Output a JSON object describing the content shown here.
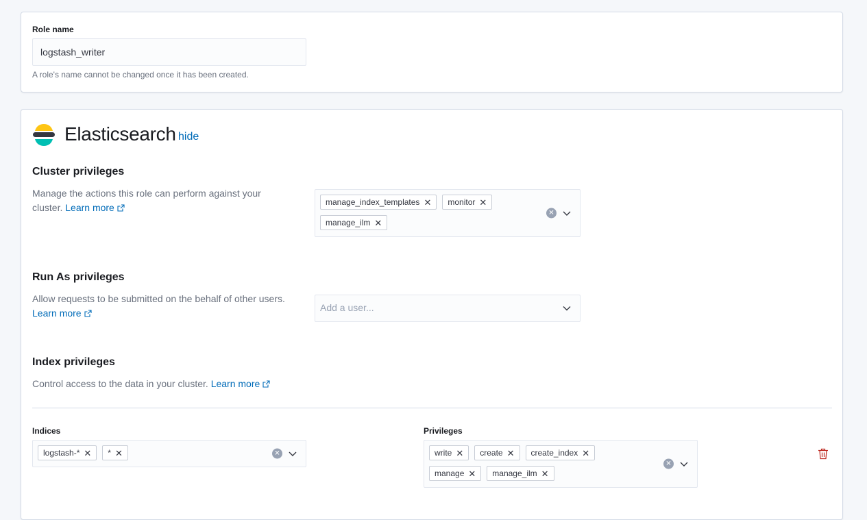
{
  "role": {
    "label": "Role name",
    "value": "logstash_writer",
    "help": "A role's name cannot be changed once it has been created."
  },
  "elasticsearch": {
    "title": "Elasticsearch",
    "hide_link": "hide",
    "cluster": {
      "title": "Cluster privileges",
      "desc": "Manage the actions this role can perform against your cluster.",
      "learn_more": "Learn more",
      "pills": [
        "manage_index_templates",
        "monitor",
        "manage_ilm"
      ]
    },
    "run_as": {
      "title": "Run As privileges",
      "desc": "Allow requests to be submitted on the behalf of other users.",
      "learn_more": "Learn more",
      "placeholder": "Add a user..."
    },
    "index": {
      "title": "Index privileges",
      "desc": "Control access to the data in your cluster.",
      "learn_more": "Learn more",
      "indices_label": "Indices",
      "indices": [
        "logstash-*",
        "*"
      ],
      "privileges_label": "Privileges",
      "privileges": [
        "write",
        "create",
        "create_index",
        "manage",
        "manage_ilm"
      ]
    }
  },
  "colors": {
    "link": "#006bb8",
    "logo_yellow": "#fec514",
    "logo_dark": "#343741",
    "logo_teal": "#00bfb3",
    "danger": "#bd271e"
  }
}
